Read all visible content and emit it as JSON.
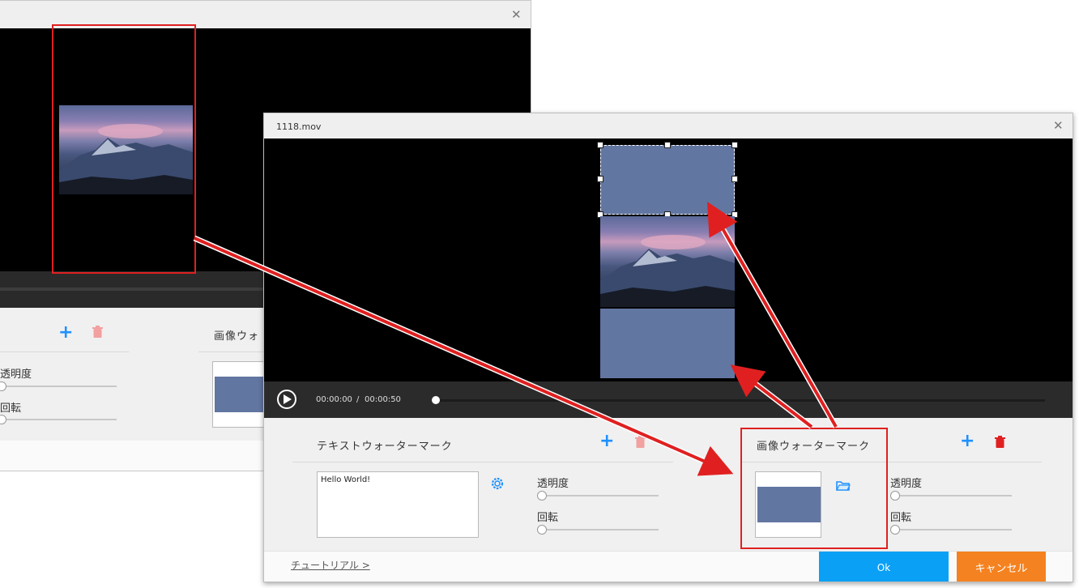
{
  "back_window": {
    "panel": {
      "opacity_label": "透明度",
      "rotation_label": "回転",
      "image_watermark_title_partial": "画像ウォ"
    }
  },
  "front_window": {
    "title": "1118.mov",
    "time": {
      "current": "00:00:00",
      "separator": "/",
      "duration": "00:00:50"
    },
    "progress_fraction": 0.0,
    "text_watermark": {
      "title": "テキストウォーターマーク",
      "text_value": "Hello World!",
      "opacity_label": "透明度",
      "rotation_label": "回転"
    },
    "image_watermark": {
      "title": "画像ウォーターマーク",
      "opacity_label": "透明度",
      "rotation_label": "回転"
    },
    "footer": {
      "tutorial_link": "チュートリアル >",
      "ok_label": "Ok",
      "cancel_label": "キャンセル"
    }
  },
  "colors": {
    "accent_blue": "#0aa0f5",
    "icon_blue": "#1e90ff",
    "cancel_orange": "#f58220",
    "delete_red": "#e02020",
    "watermark_fill": "#6276a2",
    "annotation_red": "#e02020"
  }
}
